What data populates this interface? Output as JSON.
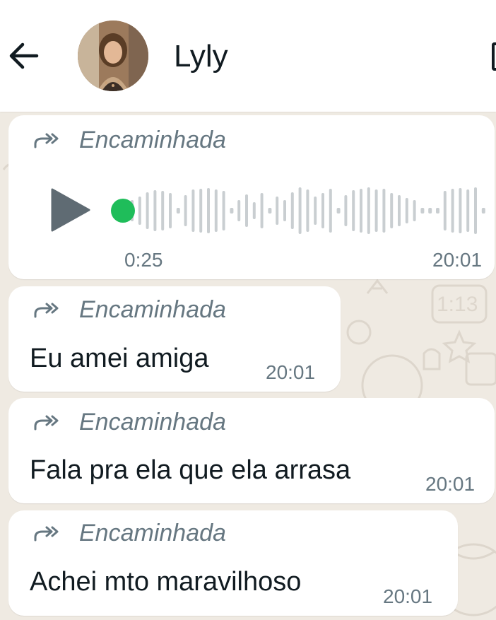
{
  "header": {
    "back_icon": "arrow-left-icon",
    "contact_name": "Lyly",
    "avatar": "contact-photo"
  },
  "colors": {
    "header_bg": "#ffffff",
    "chat_bg": "#efeae2",
    "bubble_bg": "#ffffff",
    "voice_dot": "#1fbd5a",
    "play_icon": "#5f6b73",
    "waveform": "#c9ced1",
    "meta_text": "#667781",
    "body_text": "#111b21"
  },
  "messages": [
    {
      "type": "voice",
      "forwarded_label": "Encaminhada",
      "forwarded_icon": "forward-double-arrow-icon",
      "duration": "0:25",
      "time": "20:01",
      "play_icon": "play-icon",
      "progress": 0
    },
    {
      "type": "text",
      "forwarded_label": "Encaminhada",
      "forwarded_icon": "forward-double-arrow-icon",
      "text": "Eu amei amiga",
      "time": "20:01"
    },
    {
      "type": "text",
      "forwarded_label": "Encaminhada",
      "forwarded_icon": "forward-double-arrow-icon",
      "text": "Fala pra ela que ela arrasa",
      "time": "20:01"
    },
    {
      "type": "text",
      "forwarded_label": "Encaminhada",
      "forwarded_icon": "forward-double-arrow-icon",
      "text": "Achei mto maravilhoso",
      "time": "20:01"
    }
  ]
}
